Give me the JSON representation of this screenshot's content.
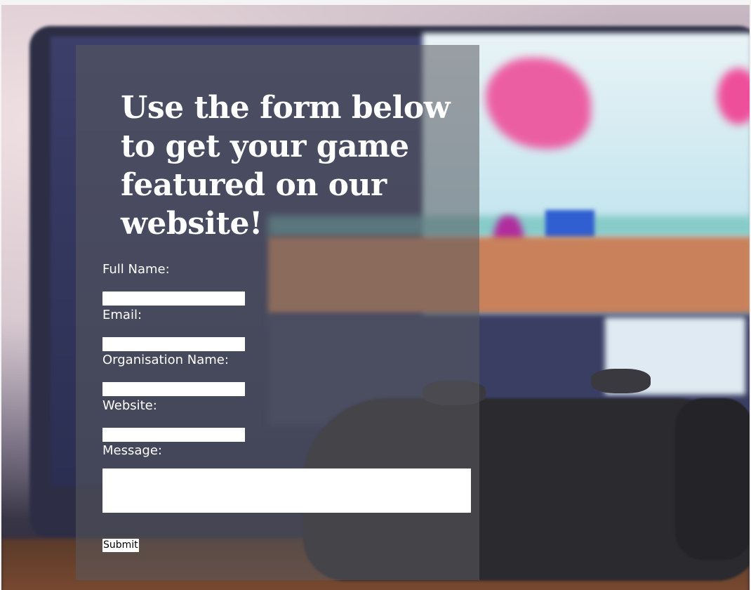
{
  "page": {
    "heading": "Use the form below to get your game featured on our website!"
  },
  "form": {
    "fields": [
      {
        "label": "Full Name:",
        "value": ""
      },
      {
        "label": "Email:",
        "value": ""
      },
      {
        "label": "Organisation Name:",
        "value": ""
      },
      {
        "label": "Website:",
        "value": ""
      }
    ],
    "message_label": "Message:",
    "message_value": "",
    "submit_label": "Submit"
  },
  "background": {
    "image": "laptop-and-game-controller-photo"
  }
}
